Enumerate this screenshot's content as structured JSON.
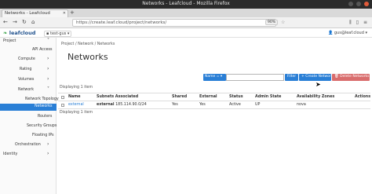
{
  "window": {
    "title": "Networks - Leafcloud - Mozilla Firefox"
  },
  "browser": {
    "tab_label": "Networks - Leafcloud",
    "url": "https://create.leaf.cloud/project/networks/",
    "zoom": "90%"
  },
  "header": {
    "logo_text": "leafcloud",
    "project": "test-gus",
    "user": "gus@leaf.cloud"
  },
  "sidebar": {
    "project": "Project",
    "api_access": "API Access",
    "compute": "Compute",
    "rating": "Rating",
    "volumes": "Volumes",
    "network": "Network",
    "network_topology": "Network Topology",
    "networks": "Networks",
    "routers": "Routers",
    "security_groups": "Security Groups",
    "floating_ips": "Floating IPs",
    "orchestration": "Orchestration",
    "identity": "Identity"
  },
  "breadcrumb": {
    "project": "Project",
    "network": "Network",
    "networks": "Networks"
  },
  "main": {
    "title": "Networks",
    "filter_field": "Name =",
    "search_placeholder": "",
    "filter_button": "Filter",
    "create_button": "+ Create Network",
    "delete_button": "Delete Networks",
    "displaying_top": "Displaying 1 item",
    "displaying_bottom": "Displaying 1 item"
  },
  "table": {
    "columns": [
      "Name",
      "Subnets Associated",
      "Shared",
      "External",
      "Status",
      "Admin State",
      "Availability Zones",
      "Actions"
    ],
    "rows": [
      {
        "name": "external",
        "subnet_name": "external",
        "subnet_cidr": "185.114.90.0/24",
        "shared": "Yes",
        "external": "Yes",
        "status": "Active",
        "admin_state": "UP",
        "zones": "nova",
        "actions": ""
      }
    ]
  },
  "colors": {
    "accent": "#2a7fd6",
    "danger": "#d96d6d",
    "brand": "#1d4f8c"
  }
}
